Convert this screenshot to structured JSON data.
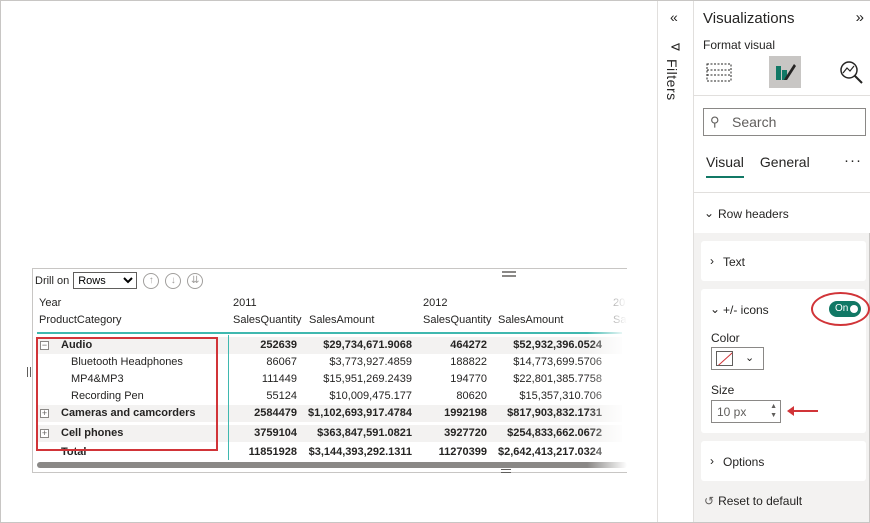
{
  "matrix": {
    "drill_label": "Drill on",
    "drill_value": "Rows",
    "row_header_1": "Year",
    "row_header_2": "ProductCategory",
    "years": [
      "2011",
      "2012",
      "20"
    ],
    "measure_headers": [
      "SalesQuantity",
      "SalesAmount",
      "SalesQuantity",
      "SalesAmount",
      "Sa"
    ],
    "rows": [
      {
        "label": "Audio",
        "level": 0,
        "expander": "−",
        "q2011": "252639",
        "a2011": "$29,734,671.9068",
        "q2012": "464272",
        "a2012": "$52,932,396.0524"
      },
      {
        "label": "Bluetooth Headphones",
        "level": 1,
        "q2011": "86067",
        "a2011": "$3,773,927.4859",
        "q2012": "188822",
        "a2012": "$14,773,699.5706"
      },
      {
        "label": "MP4&MP3",
        "level": 1,
        "q2011": "111449",
        "a2011": "$15,951,269.2439",
        "q2012": "194770",
        "a2012": "$22,801,385.7758"
      },
      {
        "label": "Recording Pen",
        "level": 1,
        "q2011": "55124",
        "a2011": "$10,009,475.177",
        "q2012": "80620",
        "a2012": "$15,357,310.706"
      },
      {
        "label": "Cameras and camcorders",
        "level": 0,
        "expander": "+",
        "q2011": "2584479",
        "a2011": "$1,102,693,917.4784",
        "q2012": "1992198",
        "a2012": "$817,903,832.1731"
      },
      {
        "label": "Cell phones",
        "level": 0,
        "expander": "+",
        "q2011": "3759104",
        "a2011": "$363,847,591.0821",
        "q2012": "3927720",
        "a2012": "$254,833,662.0672"
      },
      {
        "label": "Total",
        "level": 0,
        "q2011": "11851928",
        "a2011": "$3,144,393,292.1311",
        "q2012": "11270399",
        "a2012": "$2,642,413,217.0324"
      }
    ]
  },
  "filters": {
    "label": "Filters",
    "collapse": "«"
  },
  "pane": {
    "title": "Visualizations",
    "expand": "»",
    "subtitle": "Format visual",
    "search_placeholder": "Search",
    "tabs": [
      "Visual",
      "General"
    ],
    "more": "···",
    "section": "Row headers",
    "text_card": "Text",
    "icons_card": "+/- icons",
    "toggle": "On",
    "color_label": "Color",
    "size_label": "Size",
    "size_value": "10 px",
    "options_card": "Options",
    "reset": "Reset to default"
  },
  "colors": {
    "accent": "#117865",
    "annotation": "#d13438",
    "header_line": "#3fb8af"
  }
}
